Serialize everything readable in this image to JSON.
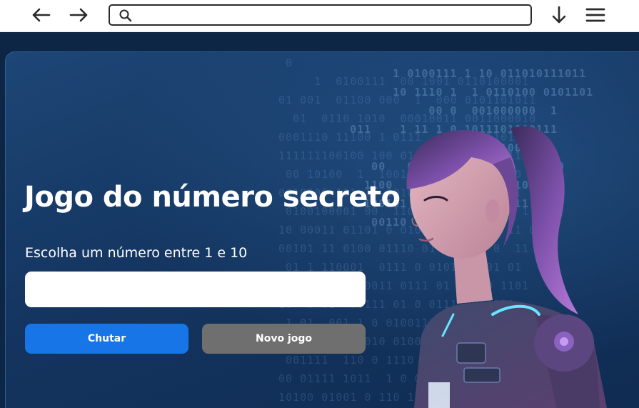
{
  "browser": {
    "url_value": "",
    "icons": {
      "back": "arrow-left-icon",
      "forward": "arrow-right-icon",
      "search": "search-icon",
      "download": "arrow-down-icon",
      "menu": "hamburger-menu-icon"
    }
  },
  "game": {
    "title": "Jogo do número secreto",
    "subtitle": "Escolha um número entre 1 e 10",
    "input_value": "",
    "guess_button_label": "Chutar",
    "new_game_button_label": "Novo jogo"
  },
  "colors": {
    "page_background": "#0d2646",
    "primary_button": "#1875e8",
    "disabled_button": "#6f6f6f",
    "text": "#ffffff"
  },
  "illustration": {
    "name": "astronaut-girl-illustration"
  }
}
